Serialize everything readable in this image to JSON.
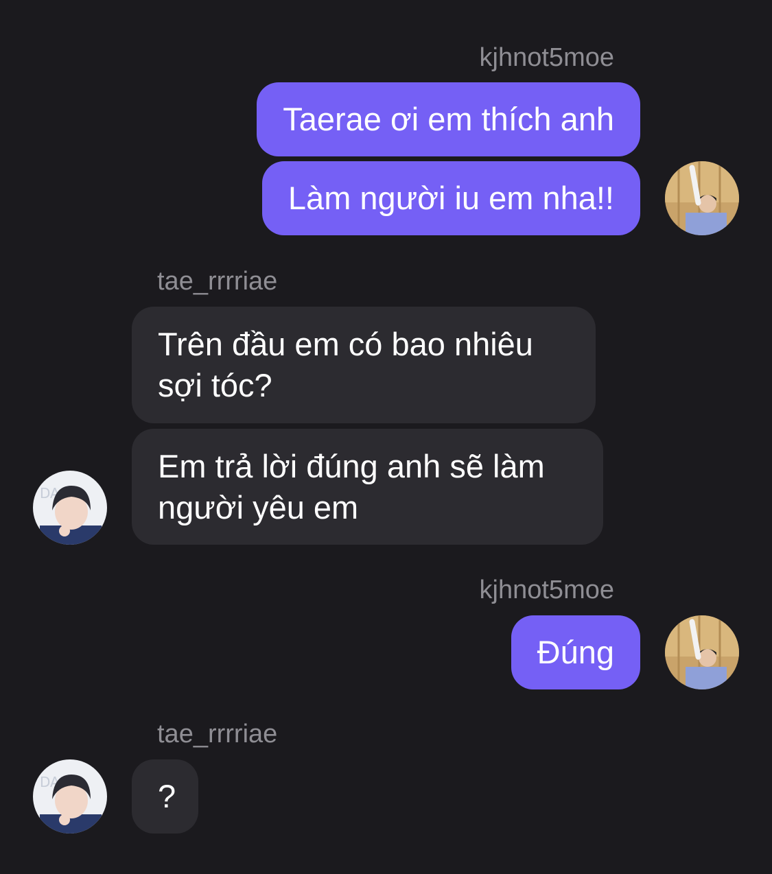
{
  "colors": {
    "background": "#1b1a1e",
    "sent_bubble": "#7560f5",
    "received_bubble": "#2c2b30",
    "username_text": "#8f8e94",
    "message_text": "#ffffff"
  },
  "thread": {
    "group1": {
      "username": "kjhnot5moe",
      "messages": [
        "Taerae ơi em thích anh",
        "Làm người iu em nha!!"
      ],
      "avatar_icon": "user-photo-avatar"
    },
    "group2": {
      "username": "tae_rrrriae",
      "messages": [
        [
          "Trên đầu em có bao nhiêu",
          "sợi tóc?"
        ],
        [
          "Em trả lời đúng anh sẽ làm",
          "người yêu em"
        ]
      ],
      "avatar_icon": "user-photo-avatar"
    },
    "group3": {
      "username": "kjhnot5moe",
      "messages": [
        "Đúng"
      ],
      "avatar_icon": "user-photo-avatar"
    },
    "group4": {
      "username": "tae_rrrriae",
      "messages": [
        "?"
      ],
      "avatar_icon": "user-photo-avatar"
    }
  }
}
